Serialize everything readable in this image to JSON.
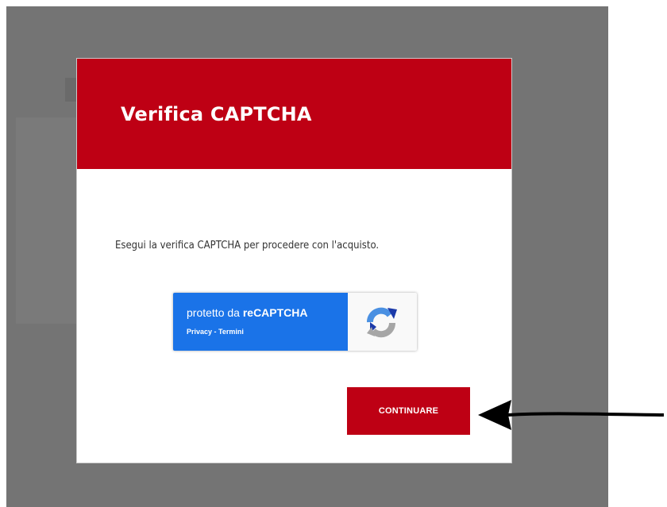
{
  "modal": {
    "title": "Verifica CAPTCHA",
    "message": "Esegui la verifica CAPTCHA per procedere con l'acquisto.",
    "continue_label": "CONTINUARE"
  },
  "recaptcha": {
    "prefix": "protetto da ",
    "brand": "reCAPTCHA",
    "privacy_label": "Privacy",
    "separator": " - ",
    "terms_label": "Termini",
    "logo_icon": "recaptcha-logo-icon"
  },
  "colors": {
    "accent": "#be0014",
    "backdrop": "#747474",
    "recaptcha_blue": "#1a73e8"
  }
}
